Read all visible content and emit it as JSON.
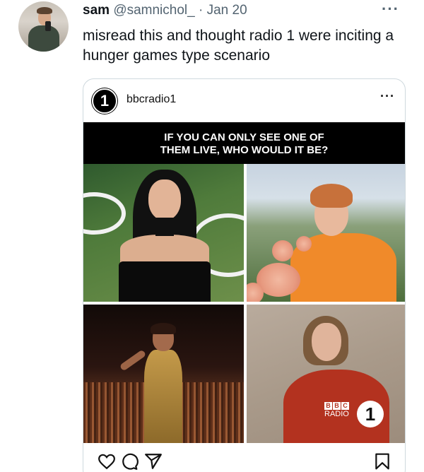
{
  "tweet": {
    "display_name": "sam",
    "handle": "@samnichol_",
    "separator": "·",
    "date": "Jan 20",
    "more_icon": "more-horizontal-icon",
    "text": "misread this and thought radio 1 were inciting a hunger games type scenario"
  },
  "embed": {
    "account": "bbcradio1",
    "logo_text": "1",
    "more_label": "···",
    "banner_line1": "IF YOU CAN ONLY SEE ONE OF",
    "banner_line2": "THEM LIVE, WHO WOULD IT BE?",
    "watermark": {
      "letters": [
        "B",
        "B",
        "C"
      ],
      "radio": "RADIO",
      "number": "1"
    },
    "actions": [
      "heart-icon",
      "comment-icon",
      "share-icon",
      "bookmark-icon"
    ]
  },
  "colors": {
    "text": "#0f1419",
    "secondary": "#536471",
    "border": "#cfd9de",
    "banner": "#000000"
  }
}
